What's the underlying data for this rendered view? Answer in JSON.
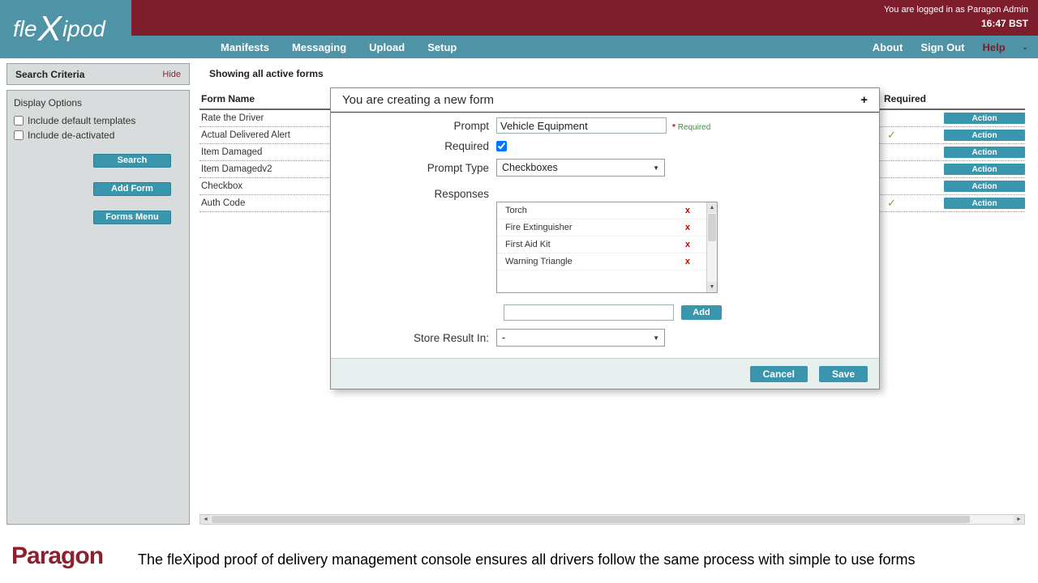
{
  "colors": {
    "maroon": "#7E1E2D",
    "teal_header": "#4E93A6",
    "teal_button": "#3996AD",
    "green_check": "#69A23C",
    "red_x": "#CC0000"
  },
  "icons": {
    "chevron_down": "▼",
    "scroll_up": "▲",
    "scroll_down": "▼",
    "scroll_left": "◄",
    "scroll_right": "►"
  },
  "topbar": {
    "logged_in_text": "You are logged in as Paragon Admin",
    "time_text": "16:47 BST"
  },
  "header": {
    "logo": {
      "pre": "fle",
      "x": "X",
      "post": "ipod"
    },
    "nav": [
      {
        "label": "Manifests"
      },
      {
        "label": "Messaging"
      },
      {
        "label": "Upload"
      },
      {
        "label": "Setup"
      }
    ],
    "right_nav": {
      "about": "About",
      "sign_out": "Sign Out",
      "help": "Help",
      "collapse": "-"
    }
  },
  "sidebar": {
    "title": "Search Criteria",
    "hide_label": "Hide",
    "display_options_label": "Display Options",
    "checkboxes": [
      {
        "label": "Include default templates"
      },
      {
        "label": "Include de-activated"
      }
    ],
    "buttons": {
      "search": "Search",
      "add_form": "Add Form",
      "forms_menu": "Forms Menu"
    }
  },
  "content": {
    "heading": "Showing all active forms",
    "table": {
      "form_name_header": "Form Name",
      "required_header": "Required",
      "action_label": "Action",
      "rows": [
        {
          "name": "Rate the Driver",
          "required_mark": ""
        },
        {
          "name": "Actual Delivered Alert",
          "required_mark": "✓"
        },
        {
          "name": "Item Damaged",
          "required_mark": ""
        },
        {
          "name": "Item Damagedv2",
          "required_mark": ""
        },
        {
          "name": "Checkbox",
          "required_mark": ""
        },
        {
          "name": "Auth Code",
          "required_mark": "✓"
        }
      ]
    }
  },
  "modal": {
    "title": "You are creating a new form",
    "collapse_icon": "+",
    "prompt_label": "Prompt",
    "prompt_value": "Vehicle Equipment",
    "required_star": "*",
    "required_hint": "Required",
    "required_label": "Required",
    "required_checked": "checked",
    "prompt_type_label": "Prompt Type",
    "prompt_type_value": "Checkboxes",
    "responses_label": "Responses",
    "responses": [
      {
        "text": "Torch",
        "remove": "x"
      },
      {
        "text": "Fire Extinguisher",
        "remove": "x"
      },
      {
        "text": "First Aid Kit",
        "remove": "x"
      },
      {
        "text": "Warning Triangle",
        "remove": "x"
      }
    ],
    "add_button": "Add",
    "store_result_label": "Store Result In:",
    "store_result_value": "-",
    "cancel_label": "Cancel",
    "save_label": "Save"
  },
  "footer": {
    "logo": "Paragon",
    "tagline": "The fleXipod proof of delivery management console ensures all drivers follow the same process with simple to use forms"
  }
}
